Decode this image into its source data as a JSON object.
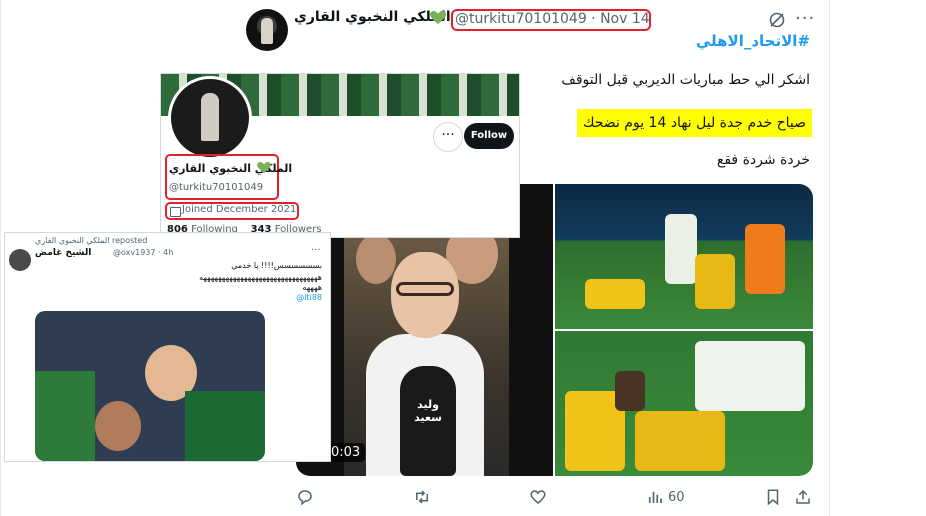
{
  "post": {
    "author_name": "الملكي النخبوي القاري",
    "handle_date": "@turkitu70101049 · Nov 14",
    "hashtag": "#الاتحاد_الاهلي",
    "line1": "اشكر الي حط مباريات الديربي قبل التوقف",
    "line2": "صياح خدم جدة ليل نهاد 14 يوم نضحك",
    "line3": "خردة شردة فقع",
    "video_time": "0:03",
    "mic_label": "وليد سعيد",
    "views": "60",
    "colors": {
      "highlight": "#ffff00",
      "annotation": "#e3202b",
      "link": "#1d9bf0"
    }
  },
  "profile_shot": {
    "name": "الملكي النخبوي القاري",
    "handle": "@turkitu70101049",
    "joined": "Joined December 2021",
    "follow_label": "Follow",
    "more_label": "···",
    "following_count": "806",
    "following_label": "Following",
    "followers_count": "343",
    "followers_label": "Followers"
  },
  "repost_shot": {
    "reposted_line": "الملكي النخبوي القاري reposted",
    "name": "الشيخ غامض",
    "handle_time": "@oxv1937 · 4h",
    "text1": "بسسسسسس!!!! يا خدمي",
    "text2": "ههههههههههههههههههههههههههههههههه",
    "text3": "ههههه",
    "link": "@lti88"
  }
}
